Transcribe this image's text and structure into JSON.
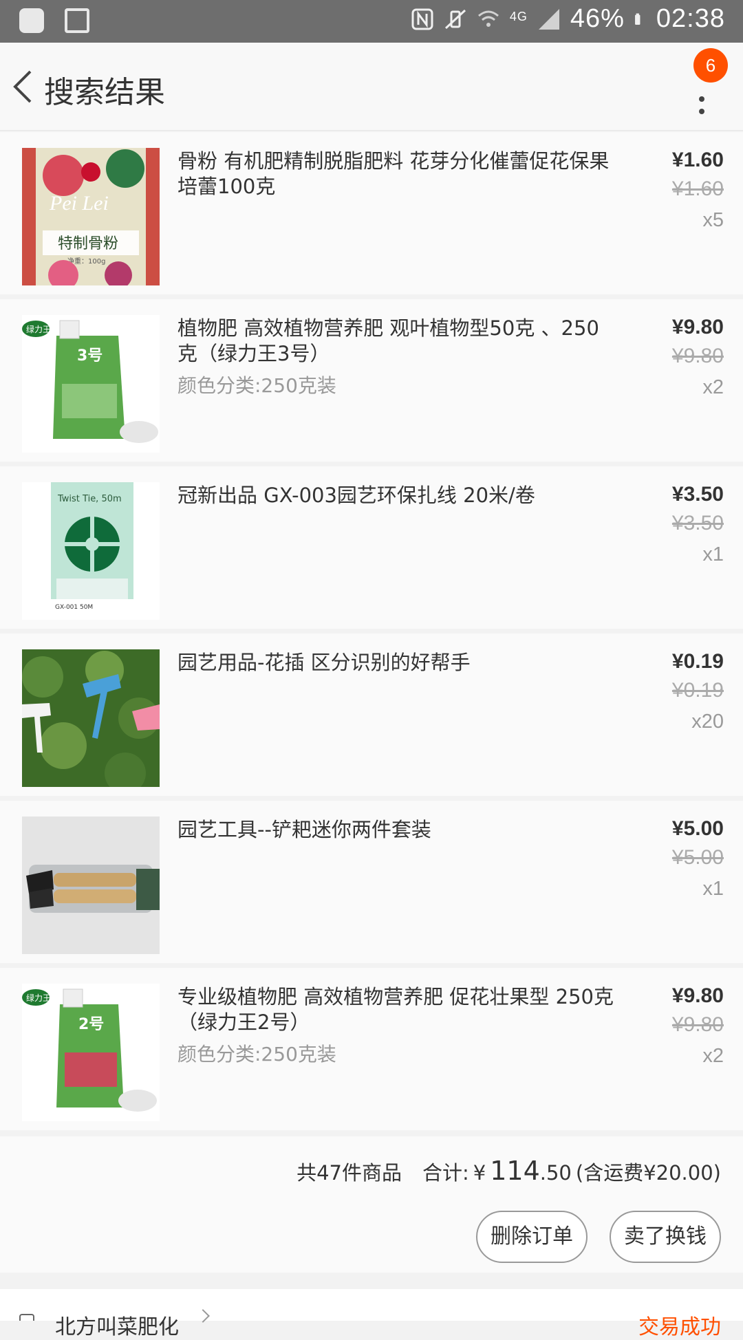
{
  "status_bar": {
    "network": "4G",
    "battery": "46%",
    "time": "02:38"
  },
  "header": {
    "title": "搜索结果",
    "badge_count": "6"
  },
  "items": [
    {
      "title": "骨粉 有机肥精制脱脂肥料 花芽分化催蕾促花保果 培蕾100克",
      "spec": "",
      "price": "¥1.60",
      "original_price": "¥1.60",
      "quantity": "x5",
      "thumb": {
        "label": "Pei Lei",
        "sub": "特制骨粉",
        "sub2": "净重：100g",
        "bg": "#cc4e43"
      }
    },
    {
      "title": "植物肥 高效植物营养肥 观叶植物型50克 、250克（绿力王3号）",
      "spec": "颜色分类:250克装",
      "price": "¥9.80",
      "original_price": "¥9.80",
      "quantity": "x2",
      "thumb": {
        "label": "绿力王",
        "sub": "3号",
        "bg": "#ffffff"
      }
    },
    {
      "title": "冠新出品 GX-003园艺环保扎线 20米/卷",
      "spec": "",
      "price": "¥3.50",
      "original_price": "¥3.50",
      "quantity": "x1",
      "thumb": {
        "label": "Twist Tie, 50m",
        "sub": "GX-001 50M",
        "bg": "#bfe5d6"
      }
    },
    {
      "title": "园艺用品-花插 区分识别的好帮手",
      "spec": "",
      "price": "¥0.19",
      "original_price": "¥0.19",
      "quantity": "x20",
      "thumb": {
        "label": "",
        "sub": "",
        "bg": "#3d6b27"
      }
    },
    {
      "title": "园艺工具--铲耙迷你两件套装",
      "spec": "",
      "price": "¥5.00",
      "original_price": "¥5.00",
      "quantity": "x1",
      "thumb": {
        "label": "",
        "sub": "",
        "bg": "#d8d8d8"
      }
    },
    {
      "title": "专业级植物肥 高效植物营养肥 促花壮果型 250克（绿力王2号）",
      "spec": "颜色分类:250克装",
      "price": "¥9.80",
      "original_price": "¥9.80",
      "quantity": "x2",
      "thumb": {
        "label": "绿力王",
        "sub": "2号",
        "bg": "#ffffff"
      }
    }
  ],
  "summary": {
    "count_text": "共47件商品",
    "total_label": "合计:",
    "total_yen": "¥",
    "total_int": "114",
    "total_dec": ".50",
    "shipping_text": "(含运费¥20.00)",
    "delete_label": "删除订单",
    "sell_label": "卖了换钱"
  },
  "next_order": {
    "store_name": "北方叫菜肥化",
    "status": "交易成功"
  },
  "colors": {
    "accent": "#ff5000",
    "status_bar": "#6e6e6e"
  }
}
